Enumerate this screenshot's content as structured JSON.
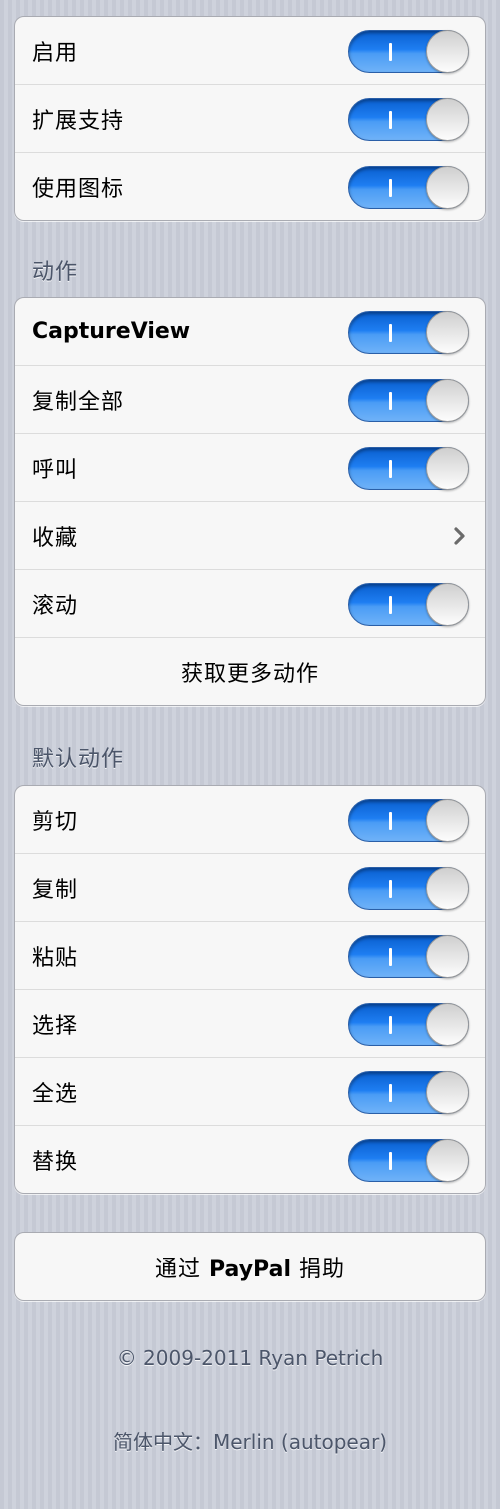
{
  "group1": {
    "rows": [
      {
        "label": "启用",
        "on": true
      },
      {
        "label": "扩展支持",
        "on": true
      },
      {
        "label": "使用图标",
        "on": true
      }
    ]
  },
  "actions": {
    "title": "动作",
    "rows": [
      {
        "label": "CaptureView",
        "on": true
      },
      {
        "label": "复制全部",
        "on": true
      },
      {
        "label": "呼叫",
        "on": true
      },
      {
        "label": "收藏"
      },
      {
        "label": "滚动",
        "on": true
      }
    ],
    "get_more": "获取更多动作"
  },
  "default_actions": {
    "title": "默认动作",
    "rows": [
      {
        "label": "剪切",
        "on": true
      },
      {
        "label": "复制",
        "on": true
      },
      {
        "label": "粘贴",
        "on": true
      },
      {
        "label": "选择",
        "on": true
      },
      {
        "label": "全选",
        "on": true
      },
      {
        "label": "替换",
        "on": true
      }
    ]
  },
  "donate": {
    "prefix": "通过 ",
    "brand": "PayPal",
    "suffix": " 捐助"
  },
  "footer": {
    "copyright": "© 2009-2011 Ryan Petrich",
    "translation": "简体中文：Merlin (autopear)"
  },
  "colors": {
    "switch_on": "#1e7ef2",
    "section_title": "#4c566a",
    "background": "#c9cdd8"
  }
}
